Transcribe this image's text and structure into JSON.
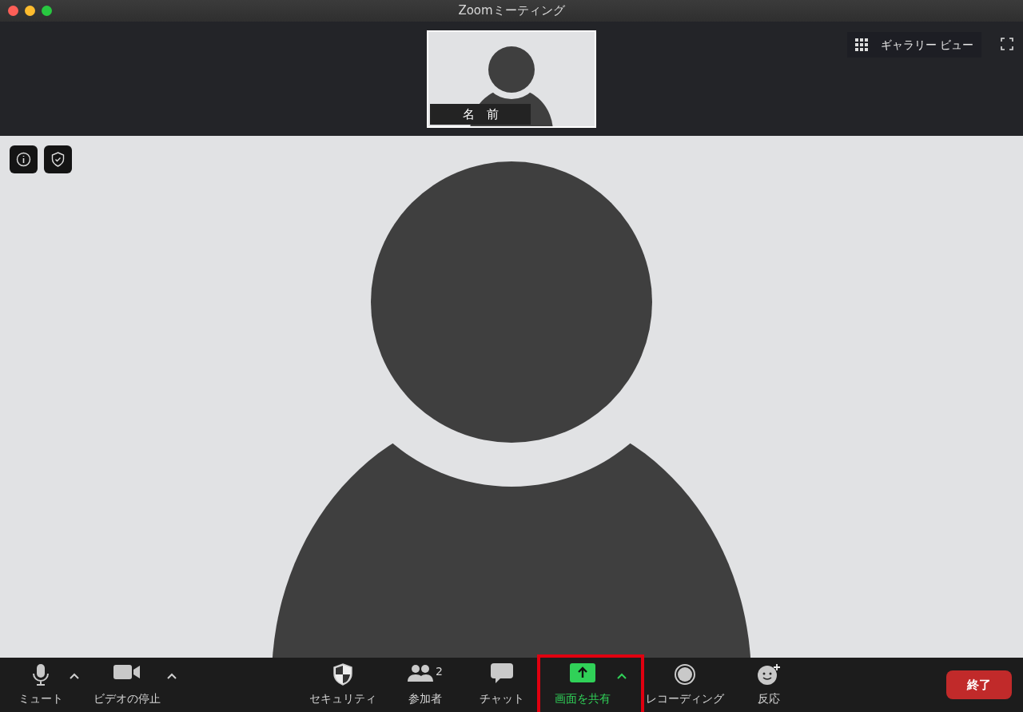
{
  "window": {
    "title": "Zoomミーティング"
  },
  "thumbnail": {
    "name": "名　前"
  },
  "view_switch": {
    "label": "ギャラリー ビュー"
  },
  "toolbar": [
    {
      "kind": "mic",
      "label": "ミュート",
      "caret": true,
      "active": false,
      "highlighted": false
    },
    {
      "kind": "video",
      "label": "ビデオの停止",
      "caret": true,
      "active": false,
      "highlighted": false
    },
    {
      "kind": "security",
      "label": "セキュリティ",
      "caret": false,
      "active": false,
      "highlighted": false
    },
    {
      "kind": "participants",
      "label": "参加者",
      "count": "2",
      "caret": false,
      "active": false,
      "highlighted": false
    },
    {
      "kind": "chat",
      "label": "チャット",
      "caret": false,
      "active": false,
      "highlighted": false
    },
    {
      "kind": "share",
      "label": "画面を共有",
      "caret": true,
      "active": true,
      "highlighted": true
    },
    {
      "kind": "record",
      "label": "レコーディング",
      "caret": false,
      "active": false,
      "highlighted": false
    },
    {
      "kind": "reaction",
      "label": "反応",
      "caret": false,
      "active": false,
      "highlighted": false
    }
  ],
  "end_button": {
    "label": "終了"
  }
}
